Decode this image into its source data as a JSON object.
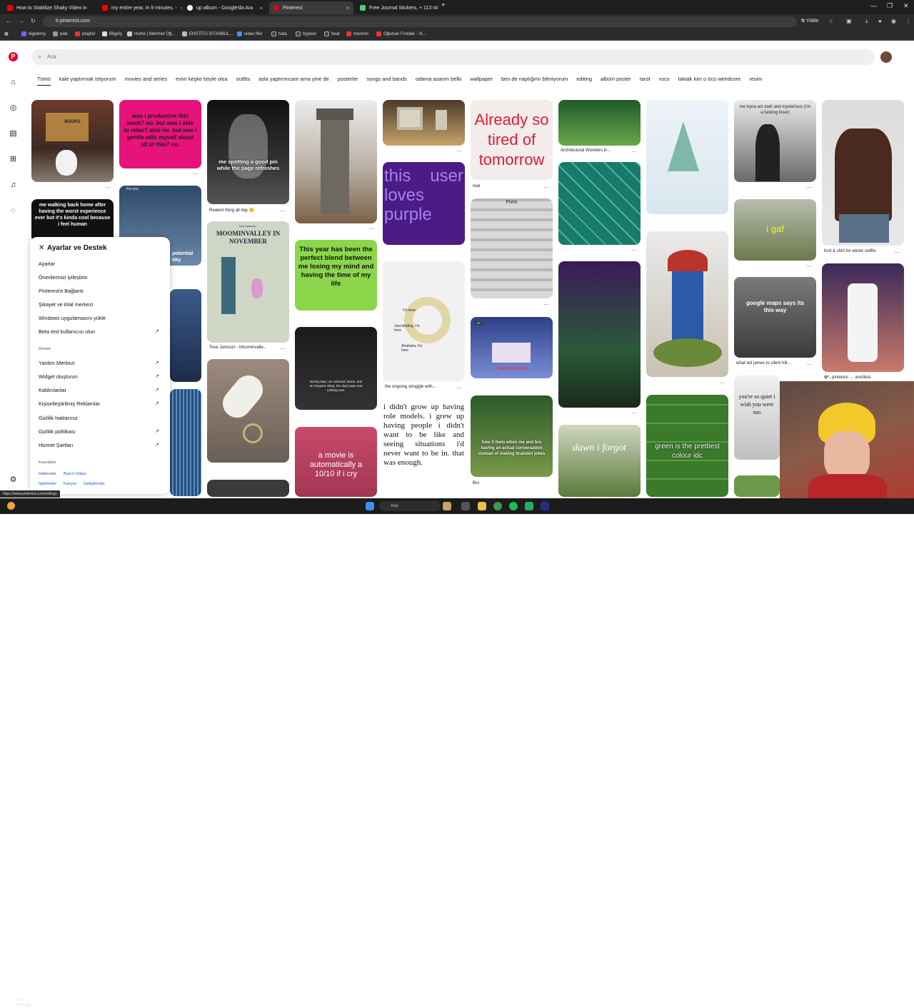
{
  "browser": {
    "tabs": [
      {
        "title": "How to Stabilize Shaky Video in",
        "color": "#ff0000"
      },
      {
        "title": "my entire year, in 9 minutes. -",
        "color": "#ff0000"
      },
      {
        "title": "up album - Google'da Ara",
        "color": "#ffffff"
      },
      {
        "title": "Pinterest",
        "color": "#e60023",
        "active": true
      },
      {
        "title": "Free Journal Stickers, + 113 sti",
        "color": "#4cd080"
      }
    ],
    "new_tab": "+",
    "window_controls": [
      "—",
      "❐",
      "✕"
    ],
    "address": "tr.pinterest.com",
    "install_label": "Yükle",
    "bookmarks": [
      "digidemy",
      "plak",
      "playlist",
      "Bilgeİş",
      "Home | Mehmet Oğ...",
      "ENSTİTÜ İSTANBUL...",
      "video fikri",
      "hata",
      "hypixel",
      "beat",
      "moomin",
      "Oğulcan Fırıldak - Vi..."
    ],
    "status_url": "https://www.pinterest.com/settings"
  },
  "pinterest": {
    "search_placeholder": "Ara",
    "categories": [
      "Tümü",
      "kale yaptırmak istiyorum",
      "movies and series",
      "evim keşke böyle olsa",
      "outfits",
      "asla yaptırmıcam ama yine de",
      "posterler",
      "songs and bands",
      "odama asarım belki",
      "wallpaper",
      "ben de naptığımı bilmiyorum",
      "editing",
      "albüm poster",
      "tarot",
      "vsco",
      "taktak kim o öcü weirdcore",
      "resim"
    ],
    "pin_texts": {
      "productive": "was i productive this week? no. but was i able to relax? also no. but was i gentle with myself about all of this? no.",
      "spotting": "me spotting a good pin while the page refreshes",
      "moominvalley": "MOOMINVALLEY IN NOVEMBER",
      "already": "Already so tired of tomorrow",
      "purple": "this user loves purple",
      "blend": "This year has been the perfect blend between me losing my mind and having the time of my life",
      "walking": "me walking back home after having the worst experience ever but it's kinda cool because i feel human",
      "role_models": "i didn't grow up having role models. i grew up having people i didn't want to be like and seeing situations i'd never want to be in. that was enough.",
      "movie": "a movie is automatically a 10/10 if i cry",
      "wizards": "how it feels when me and bro having an actual conversation instead of making braindot jokes",
      "dawn": "dawn i forgot",
      "green": "green is the prettiest colour idc",
      "igaf": "i gaf",
      "google_maps": "google maps says its this way",
      "dark": "me tryna act dark and mysterious (i'm a fucking loser)",
      "quiet": "you're so quiet i wish you were too",
      "ports": "Ports",
      "tape_im_here": "I'm here",
      "tape_kidding": "Just kidding, I'm here",
      "tape_ahahaha": "Ahahaha, I'm here",
      "for_you": "For you",
      "potential": "potential",
      "potential2": "bby",
      "christmas": "CHRISTMAS EVE",
      "boring_days": "Boring days, an unknown future, and an irregular sleep, the days pass and nothing new.",
      "gif": "GIF",
      "books": "BOOKS",
      "author": "Tove Jansson"
    },
    "captions": {
      "realest": "Realest thing all day 😌",
      "tove": "Tove Jansson - Moominvalle...",
      "real": "real",
      "architectural": "Architectural Wonders in...",
      "knit": "Knit & shirt for winter outfits",
      "tape": "the ongoing struggle with...",
      "bro": "Bro",
      "silent_hill": "what led james to silent hill...",
      "ancilla": "✿*- pinterest → ancillula"
    },
    "more_icon": "···"
  },
  "settings_menu": {
    "title": "Ayarlar ve Destek",
    "items": [
      "Ayarlar",
      "Önerilerinizi iyileştirin",
      "Pinterest'e Bağlantı",
      "Şikayet ve ihlal merkezi",
      "Windows uygulamasını yükle",
      "Beta test kullanıcısı olun"
    ],
    "section_support": "Destek",
    "support_items": [
      "Yardım Merkezi",
      "Widget oluşturun",
      "Kaldırılanlar",
      "Kişiselleştirilmiş Reklamlar",
      "Gizlilik haklarınız",
      "Gizlilik politikası",
      "Hizmet Şartları"
    ],
    "section_resources": "Kaynaklar",
    "footer_links_1": [
      "Hakkında",
      "Basın Odası"
    ],
    "footer_links_2": [
      "İşletmeler",
      "Kariyer",
      "Geliştiriciler"
    ]
  },
  "taskbar": {
    "weather_temp": "3°C",
    "weather_desc": "Güneşli",
    "search_label": "Ara"
  }
}
